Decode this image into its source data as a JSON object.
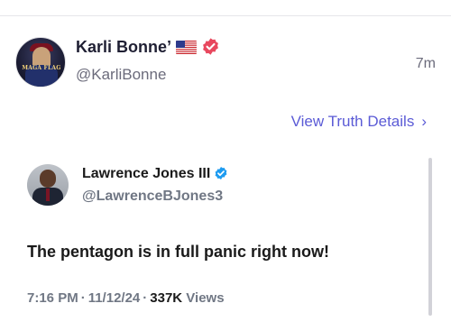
{
  "post": {
    "author_name": "Karli Bonne’",
    "author_handle": "@KarliBonne",
    "timestamp": "7m",
    "avatar_text": "MAGA FLAG",
    "verified_color": "#e8485e",
    "flag_icon": "us-flag-icon"
  },
  "details_link": {
    "label": "View Truth Details",
    "chevron": "›",
    "color": "#5b5bd6"
  },
  "quoted": {
    "author_name": "Lawrence Jones III",
    "author_handle": "@LawrenceBJones3",
    "text": "The pentagon is in full panic right now!",
    "time": "7:16 PM",
    "date": "11/12/24",
    "views_count": "337K",
    "views_label": "Views",
    "separator": "·",
    "verified_color": "#1d9bf0"
  }
}
